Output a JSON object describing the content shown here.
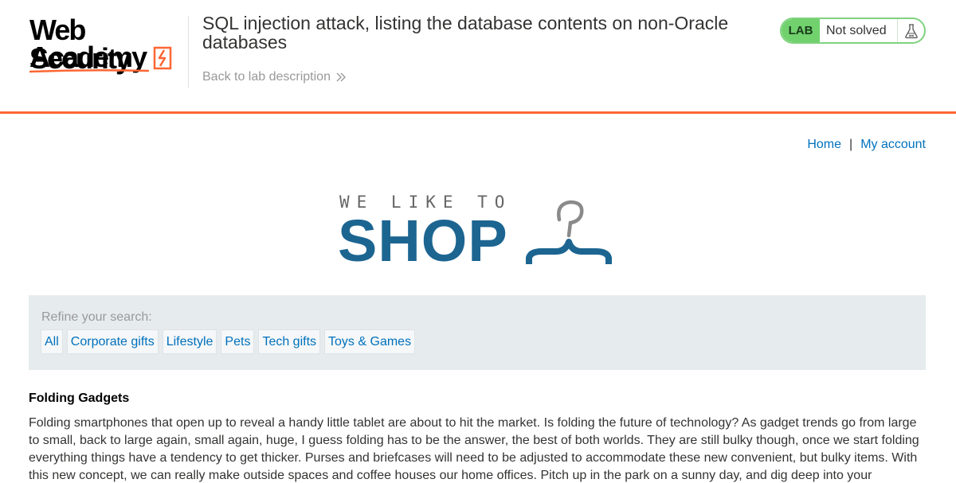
{
  "header": {
    "logo_line_1": "Web Security",
    "logo_line_2": "Academy",
    "lab_title": "SQL injection attack, listing the database contents on non-Oracle databases",
    "back_link": "Back to lab description",
    "status": {
      "badge": "LAB",
      "text": "Not solved",
      "icon": "flask-icon",
      "color": "#70d16d"
    },
    "accent_color": "#ff6633"
  },
  "nav": {
    "home": "Home",
    "separator": "|",
    "account": "My account",
    "link_color": "#0071bc"
  },
  "shop_logo": {
    "tagline": "WE LIKE TO",
    "word": "SHOP",
    "icon": "hanger-icon",
    "color": "#1c6591"
  },
  "filters": {
    "label": "Refine your search:",
    "items": [
      {
        "label": "All"
      },
      {
        "label": "Corporate gifts"
      },
      {
        "label": "Lifestyle"
      },
      {
        "label": "Pets"
      },
      {
        "label": "Tech gifts"
      },
      {
        "label": "Toys & Games"
      }
    ]
  },
  "post": {
    "title": "Folding Gadgets",
    "body": "Folding smartphones that open up to reveal a handy little tablet are about to hit the market. Is folding the future of technology? As gadget trends go from large to small, back to large again, small again, huge, I guess folding has to be the answer, the best of both worlds. They are still bulky though, once we start folding everything things have a tendency to get thicker. Purses and briefcases will need to be adjusted to accommodate these new convenient, but bulky items. With this new concept, we can really make outside spaces and coffee houses our home offices. Pitch up in the park on a sunny day, and dig deep into your oversized"
  }
}
